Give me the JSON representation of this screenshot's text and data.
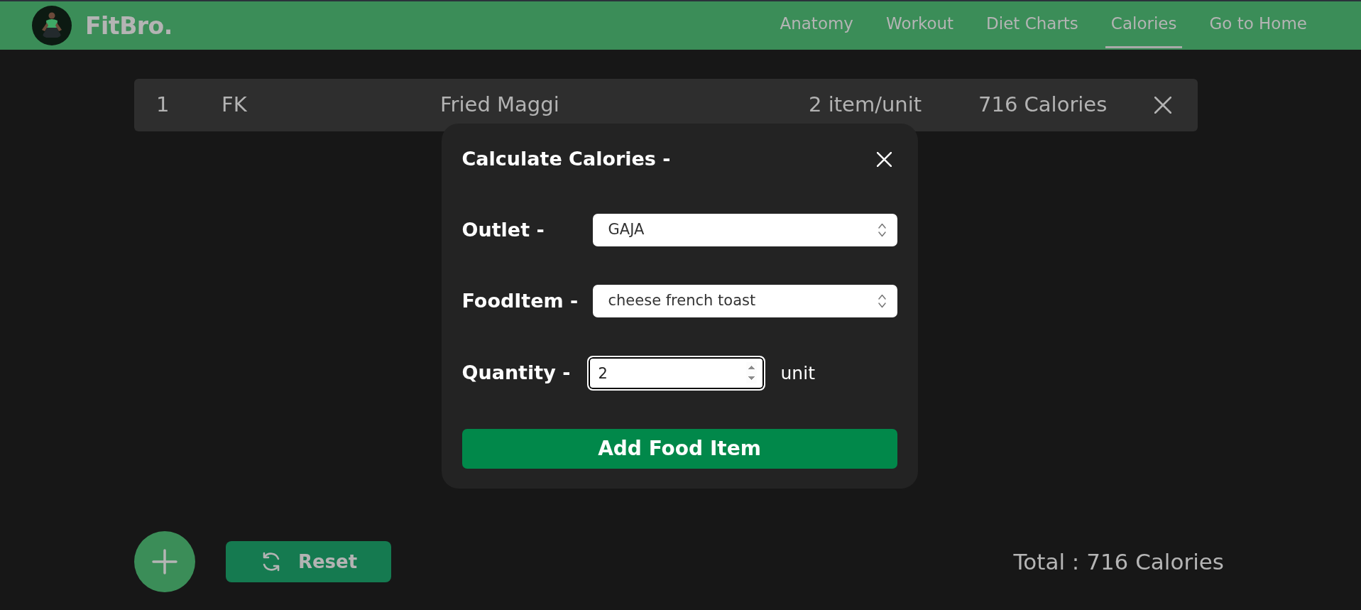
{
  "navbar": {
    "brand": "FitBro.",
    "links": [
      {
        "label": "Anatomy",
        "selected": false
      },
      {
        "label": "Workout",
        "selected": false
      },
      {
        "label": "Diet Charts",
        "selected": false
      },
      {
        "label": "Calories",
        "selected": true
      },
      {
        "label": "Go to Home",
        "selected": false
      }
    ]
  },
  "food_list": {
    "rows": [
      {
        "cells": [
          "1",
          "FK",
          "Fried Maggi",
          "2 item/unit",
          "716 Calories"
        ]
      }
    ]
  },
  "modal": {
    "title": "Calculate Calories -",
    "fields": [
      {
        "kind": "select",
        "label": "Outlet -",
        "value": "GAJA",
        "focused": false
      },
      {
        "kind": "select",
        "label": "FoodItem -",
        "value": "cheese french toast",
        "focused": false
      },
      {
        "kind": "number",
        "label": "Quantity -",
        "value": "2",
        "unit": "unit",
        "focused": true
      }
    ],
    "submit_button": "Add Food Item"
  },
  "footer": {
    "reset_button": "Reset",
    "total": "Total : 716 Calories"
  }
}
